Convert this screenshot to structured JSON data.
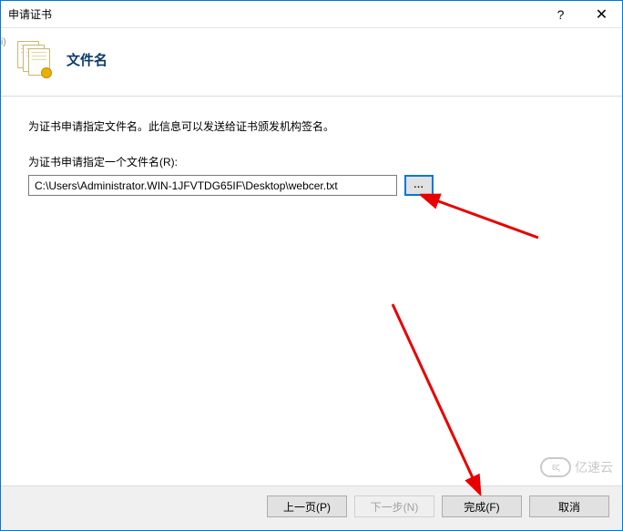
{
  "titlebar": {
    "title": "申请证书"
  },
  "header": {
    "title": "文件名"
  },
  "content": {
    "description": "为证书申请指定文件名。此信息可以发送给证书颁发机构签名。",
    "field_label": "为证书申请指定一个文件名(R):",
    "file_path": "C:\\Users\\Administrator.WIN-1JFVTDG65IF\\Desktop\\webcer.txt",
    "browse_label": "..."
  },
  "footer": {
    "prev": "上一页(P)",
    "next": "下一步(N)",
    "finish": "完成(F)",
    "cancel": "取消"
  },
  "watermark": {
    "text": "亿速云",
    "badge": "ες"
  }
}
